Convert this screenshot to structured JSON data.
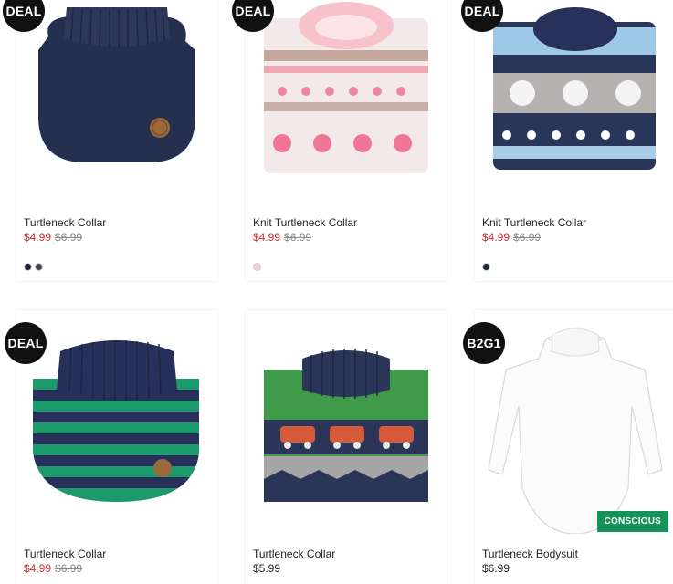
{
  "products": [
    {
      "badge": "DEAL",
      "name": "Turtleneck Collar",
      "sale_price": "$4.99",
      "old_price": "$6.99",
      "swatches": [
        "#1c2340",
        "#444a55"
      ]
    },
    {
      "badge": "DEAL",
      "name": "Knit Turtleneck Collar",
      "sale_price": "$4.99",
      "old_price": "$6.99",
      "swatches": [
        "#f6cfd3"
      ]
    },
    {
      "badge": "DEAL",
      "name": "Knit Turtleneck Collar",
      "sale_price": "$4.99",
      "old_price": "$6.99",
      "swatches": [
        "#1c2340"
      ]
    },
    {
      "badge": "DEAL",
      "name": "Turtleneck Collar",
      "sale_price": "$4.99",
      "old_price": "$6.99"
    },
    {
      "name": "Turtleneck Collar",
      "price": "$5.99"
    },
    {
      "badge": "B2G1",
      "name": "Turtleneck Bodysuit",
      "price": "$6.99",
      "tag": "CONSCIOUS"
    }
  ],
  "colors": {
    "sale": "#d62b2b",
    "badge_bg": "#111111",
    "conscious_bg": "#15935a"
  }
}
